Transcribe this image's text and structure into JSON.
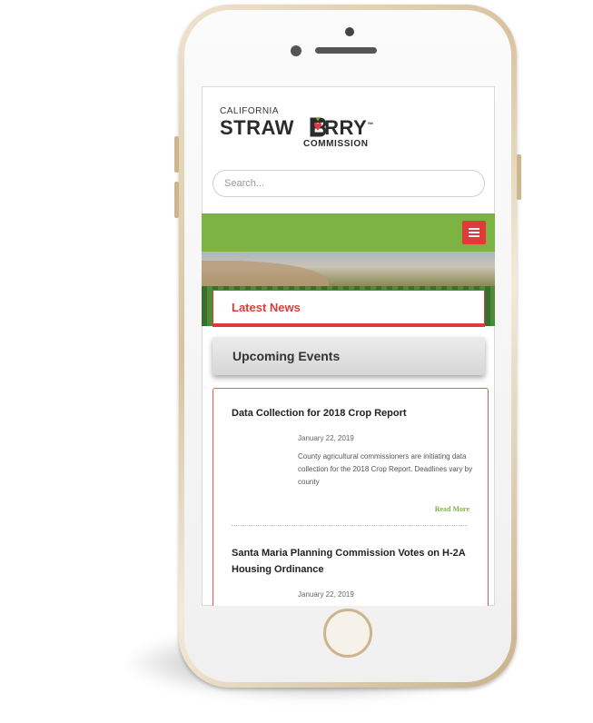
{
  "logo": {
    "top_line": "CALIFORNIA",
    "main_left": "STRAW",
    "main_right": "ERRY",
    "trademark": "™",
    "bottom_line": "COMMISSION"
  },
  "search": {
    "placeholder": "Search..."
  },
  "menu": {
    "icon": "hamburger-menu-icon"
  },
  "tabs": {
    "latest_news": "Latest News",
    "upcoming_events": "Upcoming Events"
  },
  "news": [
    {
      "title": "Data Collection for 2018 Crop Report",
      "date": "January 22, 2019",
      "body": "County agricultural commissioners are initiating data collection for the 2018 Crop Report. Deadlines vary by county",
      "read_more": "Read More"
    },
    {
      "title": "Santa Maria Planning Commission Votes on H-2A Housing Ordinance",
      "date": "January 22, 2019"
    }
  ],
  "colors": {
    "brand_green": "#7cb342",
    "brand_red": "#e23a3a",
    "phone_gold": "#d8c39e"
  }
}
